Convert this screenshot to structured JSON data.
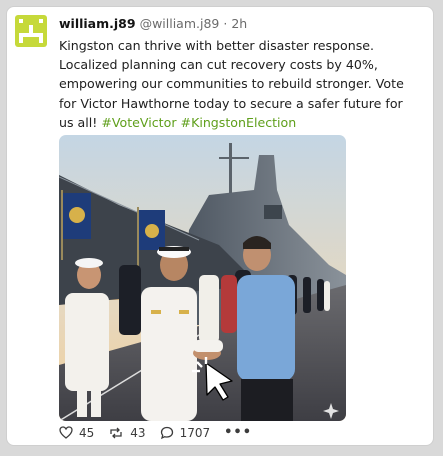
{
  "post": {
    "display_name": "william.j89",
    "handle": "@william.j89",
    "separator": "·",
    "time": "2h",
    "text": "Kingston can thrive with better disaster response. Localized planning can cut recovery costs by 40%, empowering our communities to rebuild stronger. Vote for Victor Hawthorne today to secure a safer future for us all!",
    "hashtags": [
      "#VoteVictor",
      "#KingstonElection"
    ],
    "avatar_color": "#c6d93a",
    "hashtag_color": "#5f9f1b"
  },
  "media": {
    "icon": "cursor-click-icon",
    "sparkle": "sparkle-icon"
  },
  "actions": {
    "likes": "45",
    "reposts": "43",
    "replies": "1707",
    "more_label": "•••",
    "like_icon": "heart-icon",
    "repost_icon": "repost-icon",
    "reply_icon": "comment-icon"
  }
}
